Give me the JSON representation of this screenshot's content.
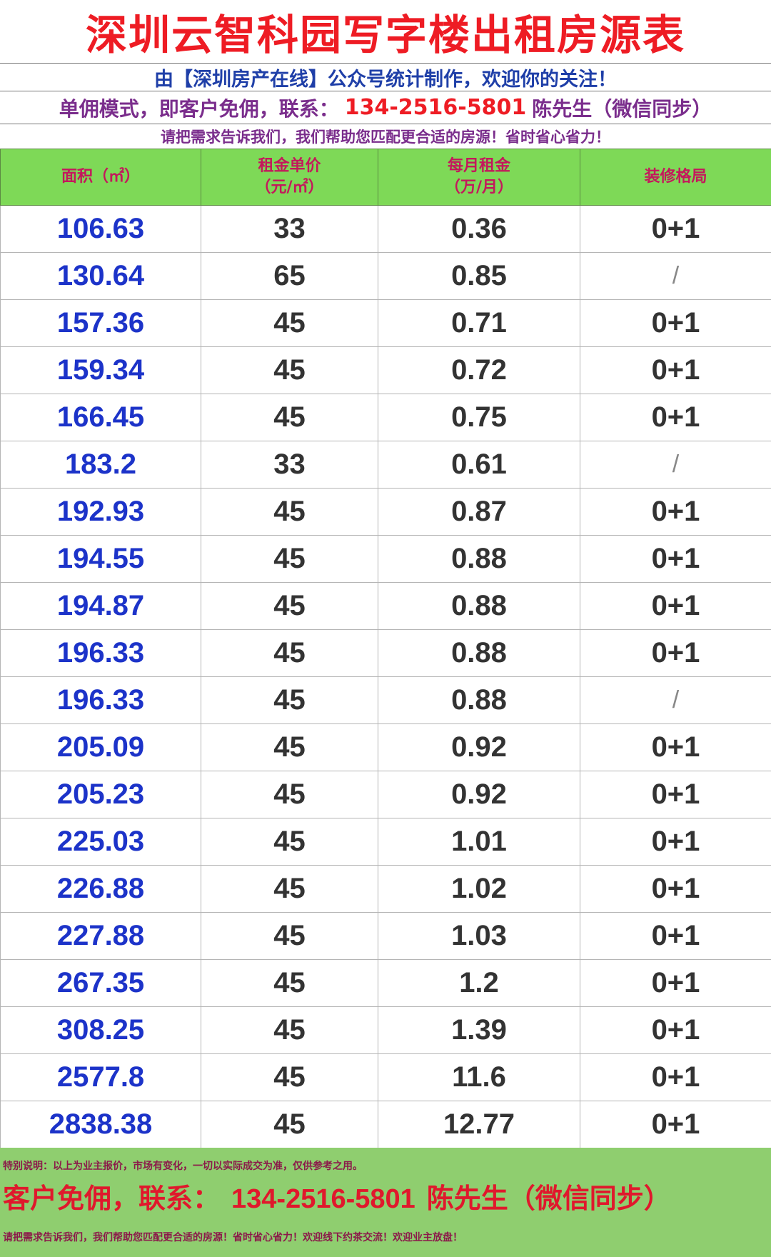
{
  "title": "深圳云智科园写字楼出租房源表",
  "subtitle": "由【深圳房产在线】公众号统计制作，欢迎你的关注！",
  "contact": {
    "prefix": "单佣模式，即客户免佣，联系：",
    "phone": "134-2516-5801",
    "suffix": "陈先生（微信同步）"
  },
  "request_line": "请把需求告诉我们，我们帮助您匹配更合适的房源！省时省心省力！",
  "headers": [
    "面积（㎡）",
    "租金单价\n（元/㎡）",
    "每月租金\n（万/月）",
    "装修格局"
  ],
  "rows": [
    [
      "106.63",
      "33",
      "0.36",
      "0+1"
    ],
    [
      "130.64",
      "65",
      "0.85",
      "/"
    ],
    [
      "157.36",
      "45",
      "0.71",
      "0+1"
    ],
    [
      "159.34",
      "45",
      "0.72",
      "0+1"
    ],
    [
      "166.45",
      "45",
      "0.75",
      "0+1"
    ],
    [
      "183.2",
      "33",
      "0.61",
      "/"
    ],
    [
      "192.93",
      "45",
      "0.87",
      "0+1"
    ],
    [
      "194.55",
      "45",
      "0.88",
      "0+1"
    ],
    [
      "194.87",
      "45",
      "0.88",
      "0+1"
    ],
    [
      "196.33",
      "45",
      "0.88",
      "0+1"
    ],
    [
      "196.33",
      "45",
      "0.88",
      "/"
    ],
    [
      "205.09",
      "45",
      "0.92",
      "0+1"
    ],
    [
      "205.23",
      "45",
      "0.92",
      "0+1"
    ],
    [
      "225.03",
      "45",
      "1.01",
      "0+1"
    ],
    [
      "226.88",
      "45",
      "1.02",
      "0+1"
    ],
    [
      "227.88",
      "45",
      "1.03",
      "0+1"
    ],
    [
      "267.35",
      "45",
      "1.2",
      "0+1"
    ],
    [
      "308.25",
      "45",
      "1.39",
      "0+1"
    ],
    [
      "2577.8",
      "45",
      "11.6",
      "0+1"
    ],
    [
      "2838.38",
      "45",
      "12.77",
      "0+1"
    ]
  ],
  "footer": {
    "note": "特别说明：以上为业主报价，市场有变化，一切以实际成交为准，仅供参考之用。",
    "contact_prefix": "客户免佣，联系：",
    "phone": "134-2516-5801",
    "contact_suffix": "陈先生（微信同步）",
    "bottom": "请把需求告诉我们，我们帮助您匹配更合适的房源！省时省心省力！欢迎线下约茶交流！欢迎业主放盘！"
  },
  "colors": {
    "title": "#ee1c24",
    "area_text": "#1c33c9",
    "header_bg": "#7ed957",
    "footer_bg": "#8fce6f"
  }
}
